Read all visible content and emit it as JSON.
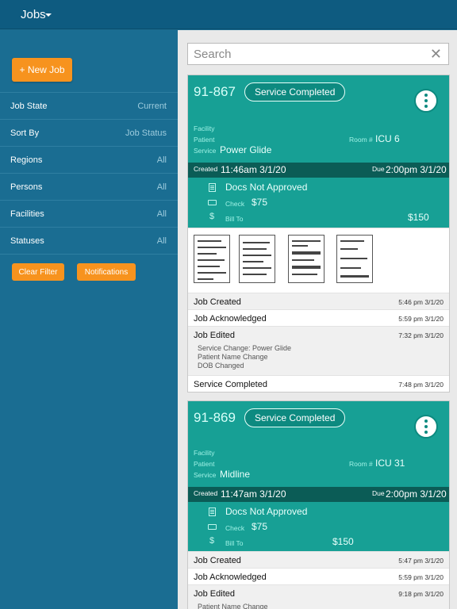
{
  "header": {
    "title": "Jobs"
  },
  "sidebar": {
    "new_job": "+ New Job",
    "filters": [
      {
        "label": "Job State",
        "value": "Current"
      },
      {
        "label": "Sort By",
        "value": "Job Status"
      },
      {
        "label": "Regions",
        "value": "All"
      },
      {
        "label": "Persons",
        "value": "All"
      },
      {
        "label": "Facilities",
        "value": "All"
      },
      {
        "label": "Statuses",
        "value": "All"
      }
    ],
    "clear_filter": "Clear Filter",
    "notifications": "Notifications"
  },
  "search": {
    "placeholder": "Search"
  },
  "labels": {
    "facility": "Facility",
    "patient": "Patient",
    "service": "Service",
    "room": "Room #",
    "created": "Created",
    "due": "Due",
    "check": "Check",
    "bill_to": "Bill To"
  },
  "jobs": [
    {
      "id": "91-867",
      "status": "Service Completed",
      "service": "Power Glide",
      "room": "ICU 6",
      "created": "11:46am 3/1/20",
      "due": "2:00pm 3/1/20",
      "docs": "Docs Not Approved",
      "check": "$75",
      "bill": "$150",
      "events": [
        {
          "title": "Job Created",
          "time": "5:46 pm",
          "date": "3/1/20"
        },
        {
          "title": "Job Acknowledged",
          "time": "5:59 pm",
          "date": "3/1/20"
        },
        {
          "title": "Job Edited",
          "time": "7:32 pm",
          "date": "3/1/20",
          "details": [
            "Service Change: Power Glide",
            "Patient Name Change",
            "DOB Changed"
          ]
        },
        {
          "title": "Service Completed",
          "time": "7:48 pm",
          "date": "3/1/20"
        }
      ]
    },
    {
      "id": "91-869",
      "status": "Service Completed",
      "service": "Midline",
      "room": "ICU 31",
      "created": "11:47am 3/1/20",
      "due": "2:00pm 3/1/20",
      "docs": "Docs Not Approved",
      "check": "$75",
      "bill": "$150",
      "events": [
        {
          "title": "Job Created",
          "time": "5:47 pm",
          "date": "3/1/20"
        },
        {
          "title": "Job Acknowledged",
          "time": "5:59 pm",
          "date": "3/1/20"
        },
        {
          "title": "Job Edited",
          "time": "9:18 pm",
          "date": "3/1/20",
          "details": [
            "Patient Name Change"
          ]
        }
      ]
    }
  ]
}
